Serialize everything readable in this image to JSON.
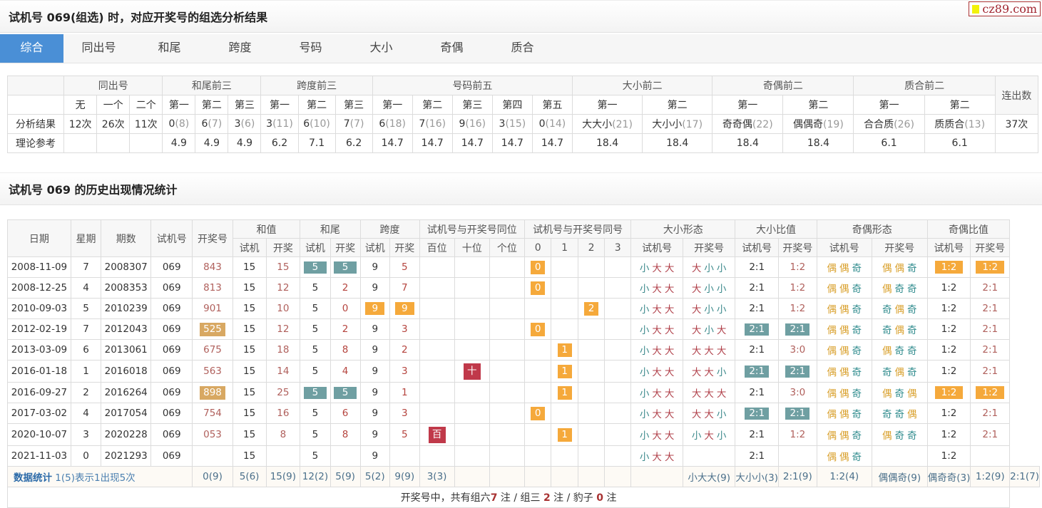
{
  "header": {
    "title": "试机号 069(组选) 时，对应开奖号的组选分析结果",
    "logo": "cz89.com"
  },
  "tabs": [
    "综合",
    "同出号",
    "和尾",
    "跨度",
    "号码",
    "大小",
    "奇偶",
    "质合"
  ],
  "analysis": {
    "group_headers": [
      "同出号",
      "和尾前三",
      "跨度前三",
      "号码前五",
      "大小前二",
      "奇偶前二",
      "质合前二",
      "连出数"
    ],
    "sub_headers": [
      "无",
      "一个",
      "二个",
      "第一",
      "第二",
      "第三",
      "第一",
      "第二",
      "第三",
      "第一",
      "第二",
      "第三",
      "第四",
      "第五",
      "第一",
      "第二",
      "第一",
      "第二",
      "第一",
      "第二"
    ],
    "row_labels": [
      "分析结果",
      "理论参考"
    ],
    "result": [
      {
        "v": "12次",
        "c": ""
      },
      {
        "v": "26次",
        "c": ""
      },
      {
        "v": "11次",
        "c": ""
      },
      {
        "v": "0",
        "c": "(8)"
      },
      {
        "v": "6",
        "c": "(7)"
      },
      {
        "v": "3",
        "c": "(6)"
      },
      {
        "v": "3",
        "c": "(11)"
      },
      {
        "v": "6",
        "c": "(10)"
      },
      {
        "v": "7",
        "c": "(7)"
      },
      {
        "v": "6",
        "c": "(18)"
      },
      {
        "v": "7",
        "c": "(16)"
      },
      {
        "v": "9",
        "c": "(16)"
      },
      {
        "v": "3",
        "c": "(15)"
      },
      {
        "v": "0",
        "c": "(14)"
      },
      {
        "v": "大大小",
        "c": "(21)"
      },
      {
        "v": "大小小",
        "c": "(17)"
      },
      {
        "v": "奇奇偶",
        "c": "(22)"
      },
      {
        "v": "偶偶奇",
        "c": "(19)"
      },
      {
        "v": "合合质",
        "c": "(26)"
      },
      {
        "v": "质质合",
        "c": "(13)"
      },
      {
        "v": "37次",
        "c": ""
      }
    ],
    "reference": [
      "",
      "",
      "",
      "4.9",
      "4.9",
      "4.9",
      "6.2",
      "7.1",
      "6.2",
      "14.7",
      "14.7",
      "14.7",
      "14.7",
      "14.7",
      "18.4",
      "18.4",
      "18.4",
      "18.4",
      "6.1",
      "6.1",
      ""
    ]
  },
  "history": {
    "title": "试机号 069 的历史出现情况统计",
    "headers": {
      "date": "日期",
      "weekday": "星期",
      "issue": "期数",
      "shiji": "试机号",
      "kaijiang": "开奖号",
      "hezhi": "和值",
      "hewei": "和尾",
      "kuadu": "跨度",
      "tongwei": "试机号与开奖号同位",
      "tonghao": "试机号与开奖号同号",
      "dxxt": "大小形态",
      "dxbz": "大小比值",
      "joxt": "奇偶形态",
      "jobz": "奇偶比值",
      "sj": "试机",
      "kj": "开奖",
      "sjh": "试机号",
      "kjh": "开奖号",
      "bai": "百位",
      "shi": "十位",
      "ge": "个位",
      "n0": "0",
      "n1": "1",
      "n2": "2",
      "n3": "3"
    },
    "rows": [
      {
        "date": "2008-11-09",
        "wd": "7",
        "issue": "2008307",
        "sj": "069",
        "kj": "843",
        "kjhl": "",
        "hz_s": "15",
        "hz_k": "15",
        "hw_s": "5",
        "hw_k": "5",
        "hw_hl": true,
        "kd_s": "9",
        "kd_k": "5",
        "kd_hl": false,
        "tw": [
          "",
          "",
          ""
        ],
        "th": [
          "0",
          "",
          "",
          ""
        ],
        "dx_s": [
          "小",
          "大",
          "大"
        ],
        "dx_k": [
          "大",
          "小",
          "小"
        ],
        "dxb_s": "2:1",
        "dxb_k": "1:2",
        "dxb_hl": false,
        "jo_s": [
          "偶",
          "偶",
          "奇"
        ],
        "jo_k": [
          "偶",
          "偶",
          "奇"
        ],
        "job_s": "1:2",
        "job_k": "1:2",
        "job_hl": true
      },
      {
        "date": "2008-12-25",
        "wd": "4",
        "issue": "2008353",
        "sj": "069",
        "kj": "813",
        "kjhl": "",
        "hz_s": "15",
        "hz_k": "12",
        "hw_s": "5",
        "hw_k": "2",
        "hw_hl": false,
        "kd_s": "9",
        "kd_k": "7",
        "kd_hl": false,
        "tw": [
          "",
          "",
          ""
        ],
        "th": [
          "0",
          "",
          "",
          ""
        ],
        "dx_s": [
          "小",
          "大",
          "大"
        ],
        "dx_k": [
          "大",
          "小",
          "小"
        ],
        "dxb_s": "2:1",
        "dxb_k": "1:2",
        "dxb_hl": false,
        "jo_s": [
          "偶",
          "偶",
          "奇"
        ],
        "jo_k": [
          "偶",
          "奇",
          "奇"
        ],
        "job_s": "1:2",
        "job_k": "2:1",
        "job_hl": false
      },
      {
        "date": "2010-09-03",
        "wd": "5",
        "issue": "2010239",
        "sj": "069",
        "kj": "901",
        "kjhl": "",
        "hz_s": "15",
        "hz_k": "10",
        "hw_s": "5",
        "hw_k": "0",
        "hw_hl": false,
        "kd_s": "9",
        "kd_k": "9",
        "kd_hl": true,
        "tw": [
          "",
          "",
          ""
        ],
        "th": [
          "",
          "",
          "2",
          ""
        ],
        "dx_s": [
          "小",
          "大",
          "大"
        ],
        "dx_k": [
          "大",
          "小",
          "小"
        ],
        "dxb_s": "2:1",
        "dxb_k": "1:2",
        "dxb_hl": false,
        "jo_s": [
          "偶",
          "偶",
          "奇"
        ],
        "jo_k": [
          "奇",
          "偶",
          "奇"
        ],
        "job_s": "1:2",
        "job_k": "2:1",
        "job_hl": false
      },
      {
        "date": "2012-02-19",
        "wd": "7",
        "issue": "2012043",
        "sj": "069",
        "kj": "525",
        "kjhl": "tan",
        "hz_s": "15",
        "hz_k": "12",
        "hw_s": "5",
        "hw_k": "2",
        "hw_hl": false,
        "kd_s": "9",
        "kd_k": "3",
        "kd_hl": false,
        "tw": [
          "",
          "",
          ""
        ],
        "th": [
          "0",
          "",
          "",
          ""
        ],
        "dx_s": [
          "小",
          "大",
          "大"
        ],
        "dx_k": [
          "大",
          "小",
          "大"
        ],
        "dxb_s": "2:1",
        "dxb_k": "2:1",
        "dxb_hl": true,
        "jo_s": [
          "偶",
          "偶",
          "奇"
        ],
        "jo_k": [
          "奇",
          "偶",
          "奇"
        ],
        "job_s": "1:2",
        "job_k": "2:1",
        "job_hl": false
      },
      {
        "date": "2013-03-09",
        "wd": "6",
        "issue": "2013061",
        "sj": "069",
        "kj": "675",
        "kjhl": "",
        "hz_s": "15",
        "hz_k": "18",
        "hw_s": "5",
        "hw_k": "8",
        "hw_hl": false,
        "kd_s": "9",
        "kd_k": "2",
        "kd_hl": false,
        "tw": [
          "",
          "",
          ""
        ],
        "th": [
          "",
          "1",
          "",
          ""
        ],
        "dx_s": [
          "小",
          "大",
          "大"
        ],
        "dx_k": [
          "大",
          "大",
          "大"
        ],
        "dxb_s": "2:1",
        "dxb_k": "3:0",
        "dxb_hl": false,
        "jo_s": [
          "偶",
          "偶",
          "奇"
        ],
        "jo_k": [
          "偶",
          "奇",
          "奇"
        ],
        "job_s": "1:2",
        "job_k": "2:1",
        "job_hl": false
      },
      {
        "date": "2016-01-18",
        "wd": "1",
        "issue": "2016018",
        "sj": "069",
        "kj": "563",
        "kjhl": "",
        "hz_s": "15",
        "hz_k": "14",
        "hw_s": "5",
        "hw_k": "4",
        "hw_hl": false,
        "kd_s": "9",
        "kd_k": "3",
        "kd_hl": false,
        "tw": [
          "",
          "十",
          ""
        ],
        "th": [
          "",
          "1",
          "",
          ""
        ],
        "dx_s": [
          "小",
          "大",
          "大"
        ],
        "dx_k": [
          "大",
          "大",
          "小"
        ],
        "dxb_s": "2:1",
        "dxb_k": "2:1",
        "dxb_hl": true,
        "jo_s": [
          "偶",
          "偶",
          "奇"
        ],
        "jo_k": [
          "奇",
          "偶",
          "奇"
        ],
        "job_s": "1:2",
        "job_k": "2:1",
        "job_hl": false
      },
      {
        "date": "2016-09-27",
        "wd": "2",
        "issue": "2016264",
        "sj": "069",
        "kj": "898",
        "kjhl": "tan",
        "hz_s": "15",
        "hz_k": "25",
        "hw_s": "5",
        "hw_k": "5",
        "hw_hl": true,
        "kd_s": "9",
        "kd_k": "1",
        "kd_hl": false,
        "tw": [
          "",
          "",
          ""
        ],
        "th": [
          "",
          "1",
          "",
          ""
        ],
        "dx_s": [
          "小",
          "大",
          "大"
        ],
        "dx_k": [
          "大",
          "大",
          "大"
        ],
        "dxb_s": "2:1",
        "dxb_k": "3:0",
        "dxb_hl": false,
        "jo_s": [
          "偶",
          "偶",
          "奇"
        ],
        "jo_k": [
          "偶",
          "奇",
          "偶"
        ],
        "job_s": "1:2",
        "job_k": "1:2",
        "job_hl": true
      },
      {
        "date": "2017-03-02",
        "wd": "4",
        "issue": "2017054",
        "sj": "069",
        "kj": "754",
        "kjhl": "",
        "hz_s": "15",
        "hz_k": "16",
        "hw_s": "5",
        "hw_k": "6",
        "hw_hl": false,
        "kd_s": "9",
        "kd_k": "3",
        "kd_hl": false,
        "tw": [
          "",
          "",
          ""
        ],
        "th": [
          "0",
          "",
          "",
          ""
        ],
        "dx_s": [
          "小",
          "大",
          "大"
        ],
        "dx_k": [
          "大",
          "大",
          "小"
        ],
        "dxb_s": "2:1",
        "dxb_k": "2:1",
        "dxb_hl": true,
        "jo_s": [
          "偶",
          "偶",
          "奇"
        ],
        "jo_k": [
          "奇",
          "奇",
          "偶"
        ],
        "job_s": "1:2",
        "job_k": "2:1",
        "job_hl": false
      },
      {
        "date": "2020-10-07",
        "wd": "3",
        "issue": "2020228",
        "sj": "069",
        "kj": "053",
        "kjhl": "",
        "hz_s": "15",
        "hz_k": "8",
        "hw_s": "5",
        "hw_k": "8",
        "hw_hl": false,
        "kd_s": "9",
        "kd_k": "5",
        "kd_hl": false,
        "tw": [
          "百",
          "",
          ""
        ],
        "th": [
          "",
          "1",
          "",
          ""
        ],
        "dx_s": [
          "小",
          "大",
          "大"
        ],
        "dx_k": [
          "小",
          "大",
          "小"
        ],
        "dxb_s": "2:1",
        "dxb_k": "1:2",
        "dxb_hl": false,
        "jo_s": [
          "偶",
          "偶",
          "奇"
        ],
        "jo_k": [
          "偶",
          "奇",
          "奇"
        ],
        "job_s": "1:2",
        "job_k": "2:1",
        "job_hl": false
      },
      {
        "date": "2021-11-03",
        "wd": "0",
        "issue": "2021293",
        "sj": "069",
        "kj": "",
        "kjhl": "",
        "hz_s": "15",
        "hz_k": "",
        "hw_s": "5",
        "hw_k": "",
        "hw_hl": false,
        "kd_s": "9",
        "kd_k": "",
        "kd_hl": false,
        "tw": [
          "",
          "",
          ""
        ],
        "th": [
          "",
          "",
          "",
          ""
        ],
        "dx_s": [
          "小",
          "大",
          "大"
        ],
        "dx_k": [],
        "dxb_s": "2:1",
        "dxb_k": "",
        "dxb_hl": false,
        "jo_s": [
          "偶",
          "偶",
          "奇"
        ],
        "jo_k": [],
        "job_s": "1:2",
        "job_k": "",
        "job_hl": false
      }
    ],
    "stats": {
      "label_bold": "数据统计",
      "label_note": "1(5)表示1出现5次",
      "values": [
        "0(9)",
        "5(6)",
        "15(9)",
        "12(2)",
        "5(9)",
        "5(2)",
        "9(9)",
        "3(3)",
        "",
        "",
        "",
        "",
        "",
        "",
        "",
        "小大大(9)",
        "大小小(3)",
        "2:1(9)",
        "1:2(4)",
        "偶偶奇(9)",
        "偶奇奇(3)",
        "1:2(9)",
        "2:1(7)"
      ]
    },
    "footer": {
      "prefix": "开奖号中，共有组六",
      "zu6": "7",
      "mid1": " 注 / 组三 ",
      "zu3": "2",
      "mid2": " 注 / 豹子 ",
      "baozi": "0",
      "suffix": " 注"
    }
  }
}
